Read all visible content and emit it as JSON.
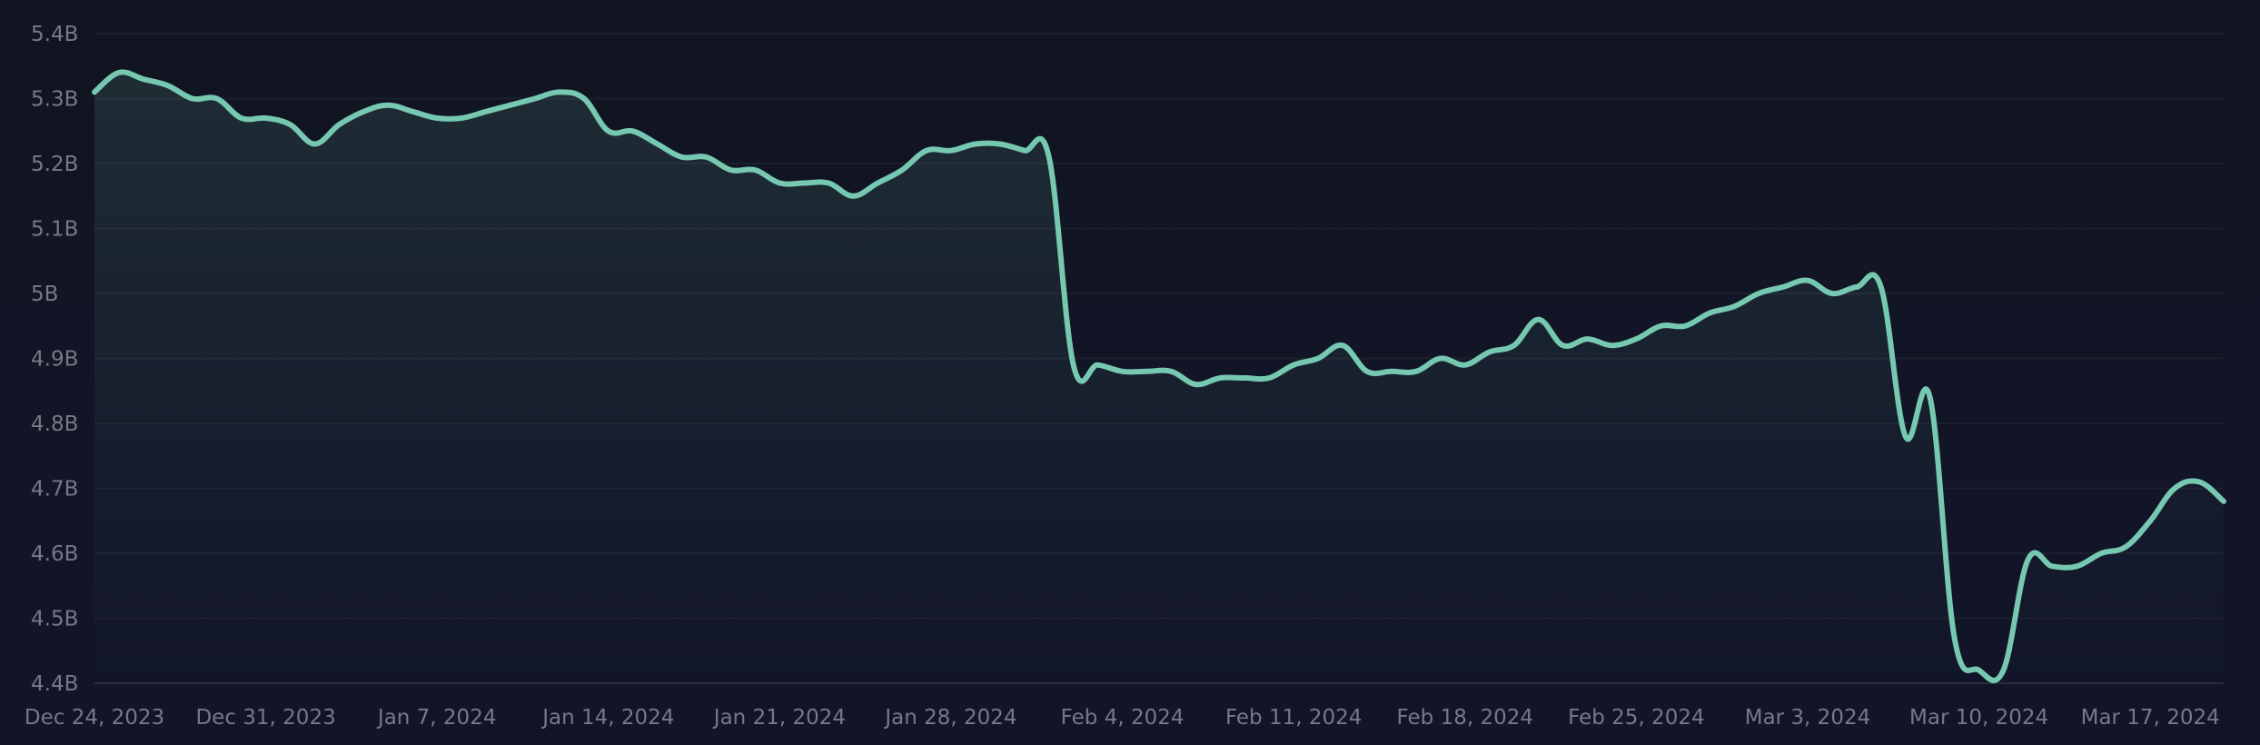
{
  "chart_data": {
    "type": "area",
    "title": "",
    "xlabel": "",
    "ylabel": "",
    "ylim": [
      4.4,
      5.4
    ],
    "y_unit_suffix": "B",
    "y_ticks": [
      {
        "value": 4.4,
        "label": "4.4B"
      },
      {
        "value": 4.5,
        "label": "4.5B"
      },
      {
        "value": 4.6,
        "label": "4.6B"
      },
      {
        "value": 4.7,
        "label": "4.7B"
      },
      {
        "value": 4.8,
        "label": "4.8B"
      },
      {
        "value": 4.9,
        "label": "4.9B"
      },
      {
        "value": 5.0,
        "label": "5B"
      },
      {
        "value": 5.1,
        "label": "5.1B"
      },
      {
        "value": 5.2,
        "label": "5.2B"
      },
      {
        "value": 5.3,
        "label": "5.3B"
      },
      {
        "value": 5.4,
        "label": "5.4B"
      }
    ],
    "x_ticks": [
      {
        "date": "2023-12-24",
        "label": "Dec 24, 2023"
      },
      {
        "date": "2023-12-31",
        "label": "Dec 31, 2023"
      },
      {
        "date": "2024-01-07",
        "label": "Jan 7, 2024"
      },
      {
        "date": "2024-01-14",
        "label": "Jan 14, 2024"
      },
      {
        "date": "2024-01-21",
        "label": "Jan 21, 2024"
      },
      {
        "date": "2024-01-28",
        "label": "Jan 28, 2024"
      },
      {
        "date": "2024-02-04",
        "label": "Feb 4, 2024"
      },
      {
        "date": "2024-02-11",
        "label": "Feb 11, 2024"
      },
      {
        "date": "2024-02-18",
        "label": "Feb 18, 2024"
      },
      {
        "date": "2024-02-25",
        "label": "Feb 25, 2024"
      },
      {
        "date": "2024-03-03",
        "label": "Mar 3, 2024"
      },
      {
        "date": "2024-03-10",
        "label": "Mar 10, 2024"
      },
      {
        "date": "2024-03-17",
        "label": "Mar 17, 2024"
      }
    ],
    "x_range": [
      "2023-12-24",
      "2024-03-20"
    ],
    "grid": true,
    "legend": "none",
    "line_color": "#76c8b0",
    "area_color": "#76c8b0",
    "series": [
      {
        "values": [
          [
            "2023-12-24",
            5.31
          ],
          [
            "2023-12-25",
            5.34
          ],
          [
            "2023-12-26",
            5.33
          ],
          [
            "2023-12-27",
            5.32
          ],
          [
            "2023-12-28",
            5.3
          ],
          [
            "2023-12-29",
            5.3
          ],
          [
            "2023-12-30",
            5.27
          ],
          [
            "2023-12-31",
            5.27
          ],
          [
            "2024-01-01",
            5.26
          ],
          [
            "2024-01-02",
            5.23
          ],
          [
            "2024-01-03",
            5.26
          ],
          [
            "2024-01-04",
            5.28
          ],
          [
            "2024-01-05",
            5.29
          ],
          [
            "2024-01-06",
            5.28
          ],
          [
            "2024-01-07",
            5.27
          ],
          [
            "2024-01-08",
            5.27
          ],
          [
            "2024-01-09",
            5.28
          ],
          [
            "2024-01-10",
            5.29
          ],
          [
            "2024-01-11",
            5.3
          ],
          [
            "2024-01-12",
            5.31
          ],
          [
            "2024-01-13",
            5.3
          ],
          [
            "2024-01-14",
            5.25
          ],
          [
            "2024-01-15",
            5.25
          ],
          [
            "2024-01-16",
            5.23
          ],
          [
            "2024-01-17",
            5.21
          ],
          [
            "2024-01-18",
            5.21
          ],
          [
            "2024-01-19",
            5.19
          ],
          [
            "2024-01-20",
            5.19
          ],
          [
            "2024-01-21",
            5.17
          ],
          [
            "2024-01-22",
            5.17
          ],
          [
            "2024-01-23",
            5.17
          ],
          [
            "2024-01-24",
            5.15
          ],
          [
            "2024-01-25",
            5.17
          ],
          [
            "2024-01-26",
            5.19
          ],
          [
            "2024-01-27",
            5.22
          ],
          [
            "2024-01-28",
            5.22
          ],
          [
            "2024-01-29",
            5.23
          ],
          [
            "2024-01-30",
            5.23
          ],
          [
            "2024-01-31",
            5.22
          ],
          [
            "2024-02-01",
            5.21
          ],
          [
            "2024-02-02",
            4.89
          ],
          [
            "2024-02-03",
            4.89
          ],
          [
            "2024-02-04",
            4.88
          ],
          [
            "2024-02-05",
            4.88
          ],
          [
            "2024-02-06",
            4.88
          ],
          [
            "2024-02-07",
            4.86
          ],
          [
            "2024-02-08",
            4.87
          ],
          [
            "2024-02-09",
            4.87
          ],
          [
            "2024-02-10",
            4.87
          ],
          [
            "2024-02-11",
            4.89
          ],
          [
            "2024-02-12",
            4.9
          ],
          [
            "2024-02-13",
            4.92
          ],
          [
            "2024-02-14",
            4.88
          ],
          [
            "2024-02-15",
            4.88
          ],
          [
            "2024-02-16",
            4.88
          ],
          [
            "2024-02-17",
            4.9
          ],
          [
            "2024-02-18",
            4.89
          ],
          [
            "2024-02-19",
            4.91
          ],
          [
            "2024-02-20",
            4.92
          ],
          [
            "2024-02-21",
            4.96
          ],
          [
            "2024-02-22",
            4.92
          ],
          [
            "2024-02-23",
            4.93
          ],
          [
            "2024-02-24",
            4.92
          ],
          [
            "2024-02-25",
            4.93
          ],
          [
            "2024-02-26",
            4.95
          ],
          [
            "2024-02-27",
            4.95
          ],
          [
            "2024-02-28",
            4.97
          ],
          [
            "2024-02-29",
            4.98
          ],
          [
            "2024-03-01",
            5.0
          ],
          [
            "2024-03-02",
            5.01
          ],
          [
            "2024-03-03",
            5.02
          ],
          [
            "2024-03-04",
            5.0
          ],
          [
            "2024-03-05",
            5.01
          ],
          [
            "2024-03-06",
            5.01
          ],
          [
            "2024-03-07",
            4.78
          ],
          [
            "2024-03-08",
            4.84
          ],
          [
            "2024-03-09",
            4.47
          ],
          [
            "2024-03-10",
            4.42
          ],
          [
            "2024-03-11",
            4.42
          ],
          [
            "2024-03-12",
            4.59
          ],
          [
            "2024-03-13",
            4.58
          ],
          [
            "2024-03-14",
            4.58
          ],
          [
            "2024-03-15",
            4.6
          ],
          [
            "2024-03-16",
            4.61
          ],
          [
            "2024-03-17",
            4.65
          ],
          [
            "2024-03-18",
            4.7
          ],
          [
            "2024-03-19",
            4.71
          ],
          [
            "2024-03-20",
            4.68
          ]
        ]
      }
    ]
  }
}
